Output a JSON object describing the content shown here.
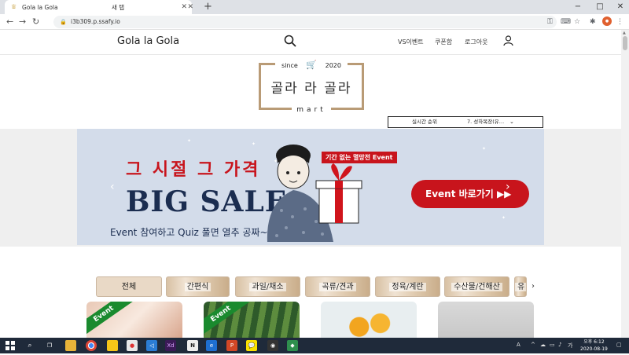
{
  "browser": {
    "tabs": [
      {
        "title": "Gola la Gola",
        "active": true
      },
      {
        "title": "새 탭",
        "active": false
      }
    ],
    "new_tab": "+",
    "url": "i3b309.p.ssafy.io",
    "window_controls": {
      "minimize": "−",
      "maximize": "□",
      "close": "✕"
    }
  },
  "site": {
    "title": "Gola la Gola",
    "nav": [
      "VS이벤트",
      "쿠폰함",
      "로그아웃"
    ]
  },
  "logo": {
    "since_left": "since",
    "since_right": "2020",
    "name": "골라 라 골라",
    "sub": "mart"
  },
  "ranking": {
    "label": "실시간 순위",
    "item": "7. 성하목장(유…"
  },
  "banner": {
    "line1": "그 시절 그 가격",
    "line2": "BIG SALE",
    "line3": "Event 참여하고 Quiz 풀면 열추 공짜~",
    "tag": "기간 없는 멸망전 Event",
    "cta": "Event 바로가기 ▶▶"
  },
  "categories": [
    "전체",
    "간편식",
    "과일/채소",
    "곡류/견과",
    "정육/계란",
    "수산물/건해산",
    "유"
  ],
  "cards": [
    {
      "ribbon": "Event"
    },
    {
      "ribbon": "Event"
    },
    {
      "ribbon": ""
    },
    {
      "ribbon": ""
    }
  ],
  "taskbar": {
    "ampm": "오후 6:12",
    "date": "2020-08-19",
    "lang": "A"
  },
  "colors": {
    "accent_red": "#c8141c",
    "navy": "#1b2d50",
    "logo_tan": "#b99b76",
    "event_green": "#1a8a2e"
  }
}
